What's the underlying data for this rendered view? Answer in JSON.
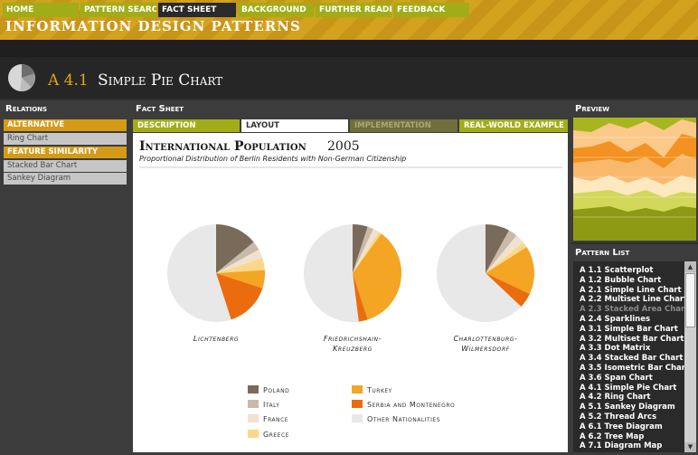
{
  "site_title": "Information Design Patterns",
  "nav": [
    "Home",
    "Pattern Search",
    "Fact Sheet",
    "Background",
    "Further Reading",
    "Feedback"
  ],
  "page": {
    "code": "A 4.1",
    "title": "Simple Pie Chart"
  },
  "panels": {
    "relations": "Relations",
    "fact_sheet": "Fact Sheet",
    "preview": "Preview",
    "pattern_list": "Pattern List"
  },
  "relations": [
    {
      "label": "Alternative",
      "kind": "header"
    },
    {
      "label": "Ring Chart",
      "kind": "item"
    },
    {
      "label": "Feature Similarity",
      "kind": "header"
    },
    {
      "label": "Stacked Bar Chart",
      "kind": "item"
    },
    {
      "label": "Sankey Diagram",
      "kind": "item"
    }
  ],
  "tabs": [
    "Description",
    "Layout",
    "Implementation",
    "Real-World Example"
  ],
  "pattern_list": [
    {
      "label": "A 1.1 Scatterplot",
      "dim": false
    },
    {
      "label": "A 1.2 Bubble Chart",
      "dim": false
    },
    {
      "label": "A 2.1 Simple Line Chart",
      "dim": false
    },
    {
      "label": "A 2.2 Multiset Line Chart",
      "dim": false
    },
    {
      "label": "A 2.3 Stacked Area Chart",
      "dim": true
    },
    {
      "label": "A 2.4 Sparklines",
      "dim": false
    },
    {
      "label": "A 3.1 Simple Bar Chart",
      "dim": false
    },
    {
      "label": "A 3.2 Multiset Bar Chart",
      "dim": false
    },
    {
      "label": "A 3.3 Dot Matrix",
      "dim": false
    },
    {
      "label": "A 3.4 Stacked Bar Chart",
      "dim": false
    },
    {
      "label": "A 3.5 Isometric Bar Chart",
      "dim": false
    },
    {
      "label": "A 3.6 Span Chart",
      "dim": false
    },
    {
      "label": "A 4.1 Simple Pie Chart",
      "dim": false
    },
    {
      "label": "A 4.2 Ring Chart",
      "dim": false
    },
    {
      "label": "A 5.1 Sankey Diagram",
      "dim": false
    },
    {
      "label": "A 5.2 Thread Arcs",
      "dim": false
    },
    {
      "label": "A 6.1 Tree Diagram",
      "dim": false
    },
    {
      "label": "A 6.2 Tree Map",
      "dim": false
    },
    {
      "label": "A 7.1 Diagram Map",
      "dim": false
    }
  ],
  "colors": {
    "poland": "#7a6a5a",
    "italy": "#c9b9a8",
    "france": "#f1e1cf",
    "greece": "#fad88a",
    "turkey": "#f3a523",
    "serbia_montenegro": "#ea6c0e",
    "other": "#e8e8e8"
  },
  "chart_data": {
    "type": "pie",
    "title": "International Population",
    "title_year": "2005",
    "subtitle": "Proportional Distribution of Berlin Residents with Non-German Citizenship",
    "categories": [
      "Poland",
      "Italy",
      "France",
      "Greece",
      "Turkey",
      "Serbia and Montenegro",
      "Other Nationalities"
    ],
    "pies": [
      {
        "name": "Lichtenberg",
        "values": [
          14,
          3,
          3,
          4,
          6,
          15,
          55
        ]
      },
      {
        "name": "Friedrichshain-Kreuzberg",
        "values": [
          5,
          2,
          2,
          1,
          35,
          3,
          52
        ]
      },
      {
        "name": "Charlottenburg-Wilmersdorf",
        "values": [
          8,
          3,
          3,
          2,
          16,
          5,
          63
        ]
      }
    ],
    "legend": [
      {
        "label": "Poland",
        "color_key": "poland"
      },
      {
        "label": "Italy",
        "color_key": "italy"
      },
      {
        "label": "France",
        "color_key": "france"
      },
      {
        "label": "Greece",
        "color_key": "greece"
      },
      {
        "label": "Turkey",
        "color_key": "turkey"
      },
      {
        "label": "Serbia and Montenegro",
        "color_key": "serbia_montenegro"
      },
      {
        "label": "Other Nationalities",
        "color_key": "other"
      }
    ]
  }
}
